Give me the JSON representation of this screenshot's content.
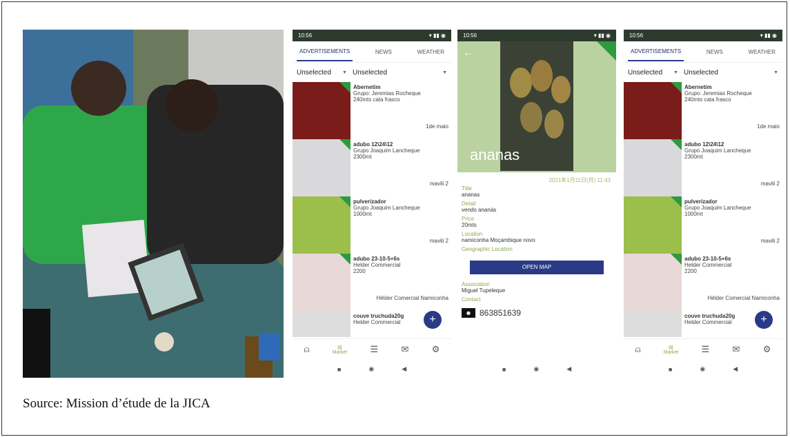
{
  "caption": "Source: Mission d’étude de la JICA",
  "status_time": "10:56",
  "tabs": [
    "ADVERTISEMENTS",
    "NEWS",
    "WEATHER"
  ],
  "filters": [
    "Unselected",
    "Unselected"
  ],
  "list": [
    {
      "title": "Abernetim",
      "lines": [
        "Grupo: Jeremias Rocheque",
        "240mts cata frasco"
      ],
      "right": "1de maio"
    },
    {
      "title": "adubo 12\\24\\12",
      "lines": [
        "Grupo Joaquim Lancheque",
        "2300mt"
      ],
      "right": "mavili 2"
    },
    {
      "title": "pulverizador",
      "lines": [
        "Grupo Joaquim Lancheque",
        "1000mt"
      ],
      "right": "mavili 2"
    },
    {
      "title": "adubo 23-10-5+6s",
      "lines": [
        "Helder Commercial",
        "2200"
      ],
      "right": "Hélder Comercial Namiconha"
    },
    {
      "title": "couve truchuda20g",
      "lines": [
        "Helder Commercial"
      ],
      "right": ""
    }
  ],
  "bottom_nav": {
    "market_label": "Market"
  },
  "detail": {
    "name": "ananas",
    "date": "2021年1月11日(月) 11:43",
    "fields": [
      {
        "label": "Title",
        "value": "ananas"
      },
      {
        "label": "Detail",
        "value": "vendo ananás"
      },
      {
        "label": "Price",
        "value": "20mts"
      },
      {
        "label": "Location",
        "value": "namiconha Moçambique novo"
      }
    ],
    "geo_label": "Geographic Location",
    "open_map": "OPEN MAP",
    "association_label": "Association",
    "association_value": "Miguel Tupeleque",
    "contact_label": "Contact",
    "phone": "863851639"
  }
}
